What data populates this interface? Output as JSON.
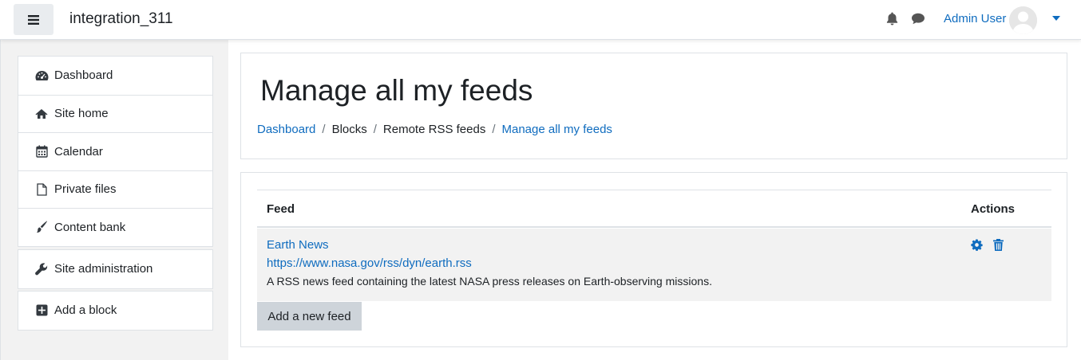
{
  "navbar": {
    "site_name": "integration_311",
    "user_name": "Admin User"
  },
  "sidebar": {
    "items": [
      {
        "label": "Dashboard",
        "icon": "dashboard-icon"
      },
      {
        "label": "Site home",
        "icon": "home-icon"
      },
      {
        "label": "Calendar",
        "icon": "calendar-icon"
      },
      {
        "label": "Private files",
        "icon": "file-icon"
      },
      {
        "label": "Content bank",
        "icon": "paintbrush-icon"
      }
    ],
    "admin": {
      "label": "Site administration",
      "icon": "wrench-icon"
    },
    "add_block": {
      "label": "Add a block",
      "icon": "plus-square-icon"
    }
  },
  "header": {
    "title": "Manage all my feeds",
    "breadcrumb": [
      "Dashboard",
      "Blocks",
      "Remote RSS feeds",
      "Manage all my feeds"
    ]
  },
  "table": {
    "columns": [
      "Feed",
      "Actions"
    ],
    "rows": [
      {
        "title": "Earth News",
        "url": "https://www.nasa.gov/rss/dyn/earth.rss",
        "description": "A RSS news feed containing the latest NASA press releases on Earth-observing missions."
      }
    ]
  },
  "buttons": {
    "add_feed": "Add a new feed"
  },
  "colors": {
    "link": "#0f6cbf",
    "drawer_bg": "#f2f2f2",
    "button_bg": "#ced4da"
  }
}
